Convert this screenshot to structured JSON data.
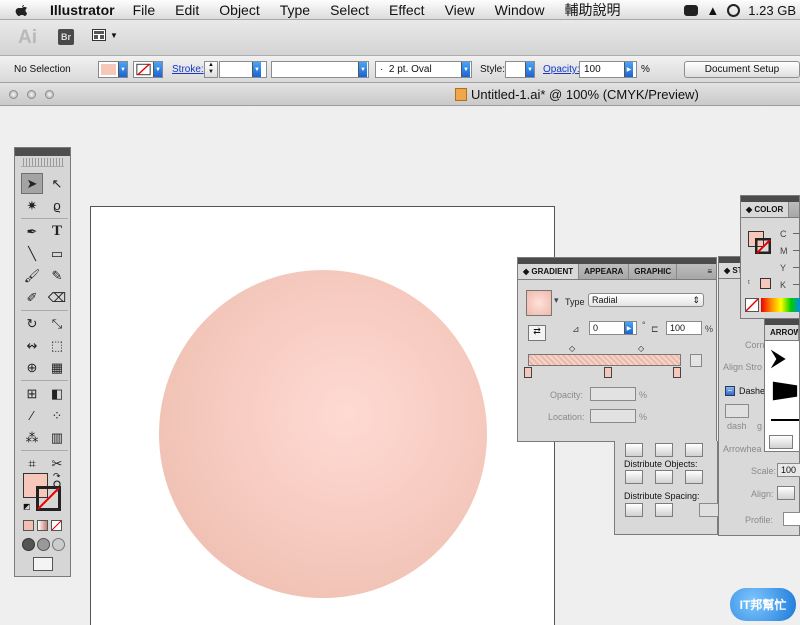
{
  "menubar": {
    "app_name": "Illustrator",
    "items": [
      "File",
      "Edit",
      "Object",
      "Type",
      "Select",
      "Effect",
      "View",
      "Window",
      "輔助說明"
    ],
    "tray_text": "1.23 GB"
  },
  "appbar": {
    "logo": "Ai",
    "bridge_label": "Br"
  },
  "control": {
    "selection": "No Selection",
    "stroke_label": "Stroke:",
    "brush_value": "2 pt. Oval",
    "style_label": "Style:",
    "opacity_label": "Opacity:",
    "opacity_value": "100",
    "opacity_unit": "%",
    "document_setup": "Document Setup"
  },
  "document": {
    "title": "Untitled-1.ai* @ 100% (CMYK/Preview)"
  },
  "gradient_panel": {
    "tabs": [
      "GRADIENT",
      "APPEARA",
      "GRAPHIC"
    ],
    "type_label": "Type",
    "type_value": "Radial",
    "angle_value": "0",
    "aspect_value": "100",
    "percent": "%",
    "opacity_label": "Opacity:",
    "location_label": "Location:"
  },
  "color_panel": {
    "tab": "COLOR",
    "channels": [
      "C",
      "M",
      "Y",
      "K"
    ]
  },
  "stroke_panel": {
    "tab": "ST",
    "corner_label": "Corn",
    "align_label": "Align Stro",
    "dashed_label": "Dashe",
    "dash_label": "dash",
    "gap_label": "g",
    "arrowheads_label": "Arrowhea",
    "scale_label": "Scale:",
    "scale_value": "100",
    "align2_label": "Align:",
    "profile_label": "Profile:"
  },
  "align_panel": {
    "distribute_objects": "Distribute Objects:",
    "distribute_spacing": "Distribute Spacing:"
  },
  "arrows_panel": {
    "tab": "ARROW"
  },
  "watermark": {
    "text": "IT邦幫忙"
  },
  "colors": {
    "fill": "#f6c8bc",
    "circle_center": "#fedad3",
    "circle_edge": "#e7b7a8",
    "selection_blue": "#1a64d2"
  }
}
